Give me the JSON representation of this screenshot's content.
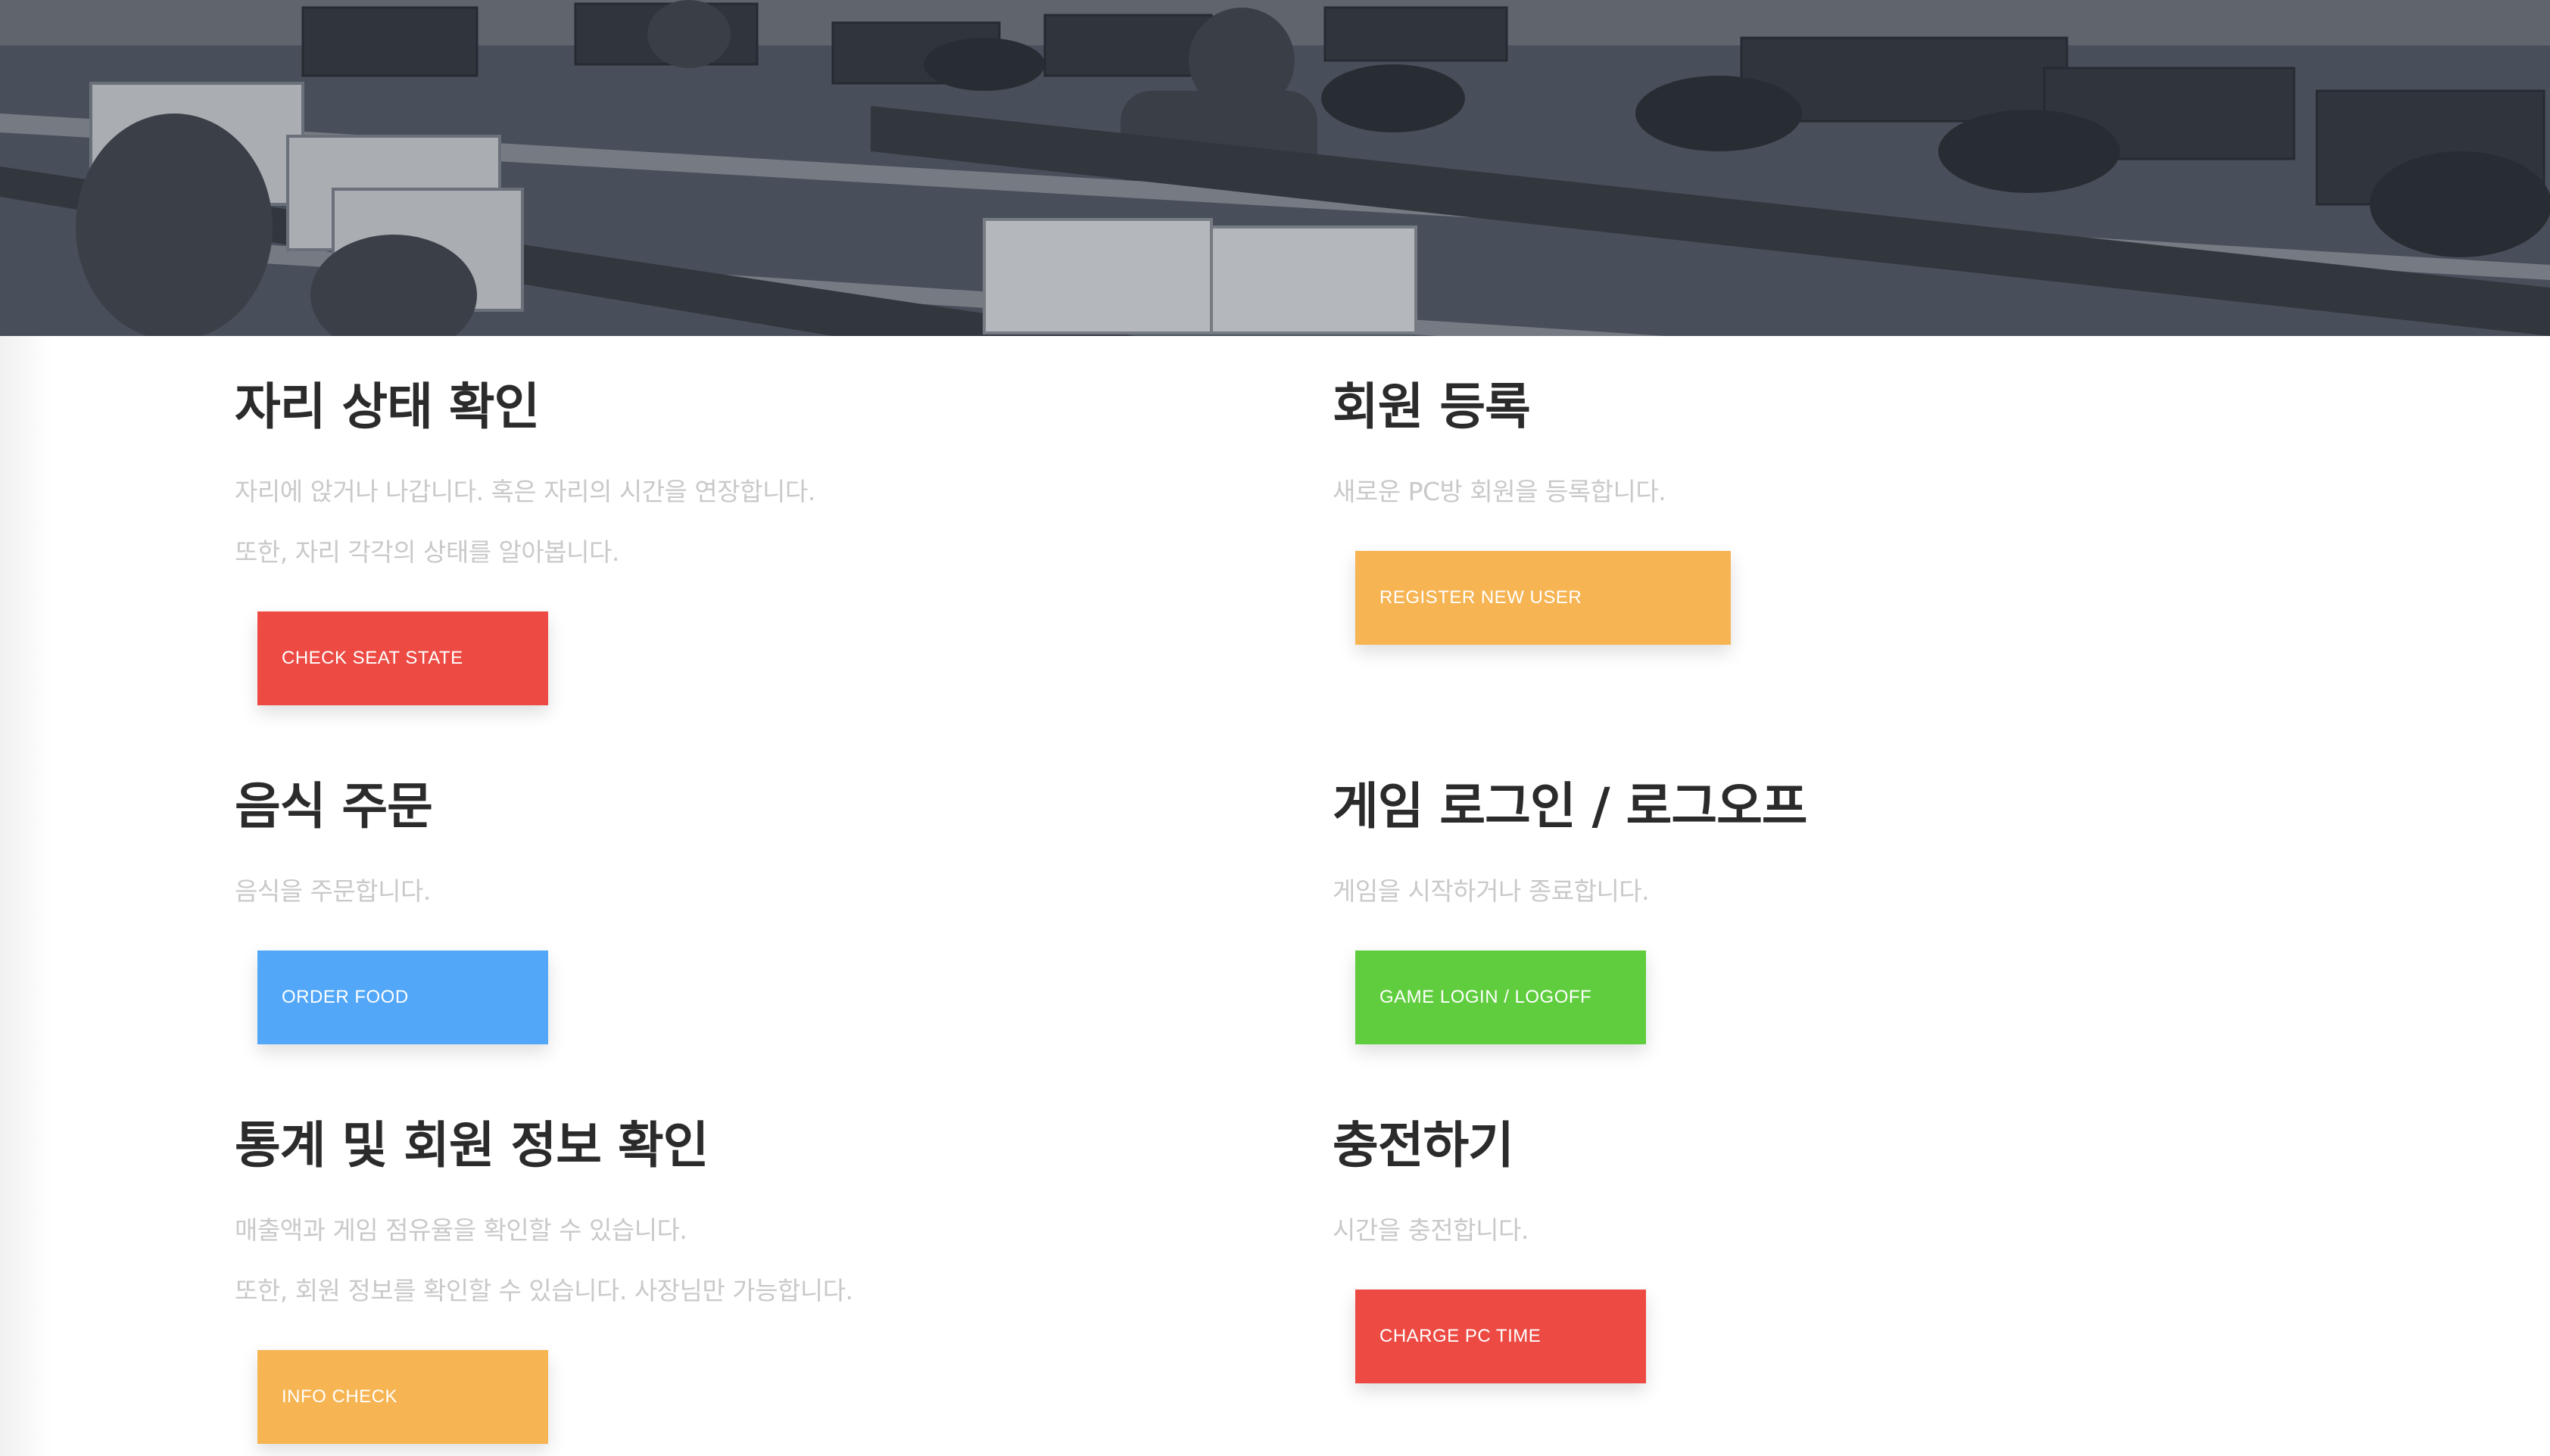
{
  "sections": [
    {
      "title": "자리 상태 확인",
      "desc": [
        "자리에 앉거나 나갑니다. 혹은 자리의 시간을 연장합니다.",
        "또한, 자리 각각의 상태를 알아봅니다."
      ],
      "button": "CHECK SEAT STATE",
      "color": "#ec4a43"
    },
    {
      "title": "회원 등록",
      "desc": [
        "새로운 PC방 회원을 등록합니다."
      ],
      "button": "REGISTER NEW USER",
      "color": "#f6b453"
    },
    {
      "title": "음식 주문",
      "desc": [
        "음식을 주문합니다."
      ],
      "button": "ORDER FOOD",
      "color": "#52a7f8"
    },
    {
      "title": "게임 로그인 / 로그오프",
      "desc": [
        "게임을 시작하거나 종료합니다."
      ],
      "button": "GAME LOGIN / LOGOFF",
      "color": "#5fcd3e"
    },
    {
      "title": "통계 및 회원 정보 확인",
      "desc": [
        "매출액과 게임 점유율을 확인할 수 있습니다.",
        "또한, 회원 정보를 확인할 수 있습니다. 사장님만 가능합니다."
      ],
      "button": "INFO CHECK",
      "color": "#f6b453"
    },
    {
      "title": "충전하기",
      "desc": [
        "시간을 충전합니다."
      ],
      "button": "CHARGE PC TIME",
      "color": "#ec4a43"
    }
  ]
}
